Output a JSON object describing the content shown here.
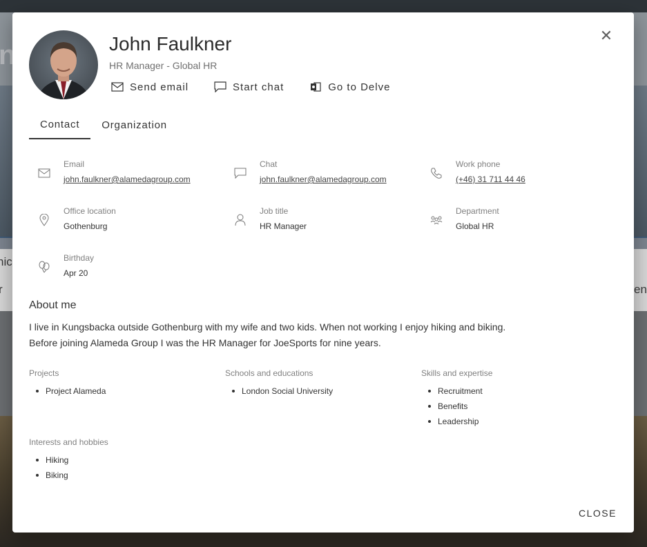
{
  "backdrop": {
    "fragment_left_big": "ni",
    "fragment_left_1": "nic",
    "fragment_left_2": "r",
    "fragment_right": "en"
  },
  "profile": {
    "name": "John Faulkner",
    "subtitle": "HR Manager - Global HR"
  },
  "actions": [
    {
      "label": "Send email",
      "icon": "mail-icon"
    },
    {
      "label": "Start chat",
      "icon": "chat-icon"
    },
    {
      "label": "Go to Delve",
      "icon": "delve-icon"
    }
  ],
  "tabs": [
    {
      "label": "Contact",
      "active": true
    },
    {
      "label": "Organization",
      "active": false
    }
  ],
  "fields": {
    "email": {
      "label": "Email",
      "value": "john.faulkner@alamedagroup.com"
    },
    "chat": {
      "label": "Chat",
      "value": "john.faulkner@alamedagroup.com"
    },
    "work_phone": {
      "label": "Work phone",
      "value": "(+46) 31 711 44 46"
    },
    "office": {
      "label": "Office location",
      "value": "Gothenburg"
    },
    "job_title": {
      "label": "Job title",
      "value": "HR Manager"
    },
    "department": {
      "label": "Department",
      "value": "Global HR"
    },
    "birthday": {
      "label": "Birthday",
      "value": "Apr 20"
    }
  },
  "about": {
    "heading": "About me",
    "line1": "I live in Kungsbacka outside Gothenburg with my wife and two kids. When not working I enjoy hiking and biking.",
    "line2": "Before joining Alameda Group I was the HR Manager for JoeSports for nine years."
  },
  "lists": {
    "projects": {
      "heading": "Projects",
      "items": [
        "Project Alameda"
      ]
    },
    "schools": {
      "heading": "Schools and educations",
      "items": [
        "London Social University"
      ]
    },
    "skills": {
      "heading": "Skills and expertise",
      "items": [
        "Recruitment",
        "Benefits",
        "Leadership"
      ]
    },
    "interests": {
      "heading": "Interests and hobbies",
      "items": [
        "Hiking",
        "Biking"
      ]
    }
  },
  "footer": {
    "close_label": "CLOSE"
  },
  "colors": {
    "text": "#333333",
    "muted": "#808080",
    "modal_bg": "#ffffff"
  }
}
